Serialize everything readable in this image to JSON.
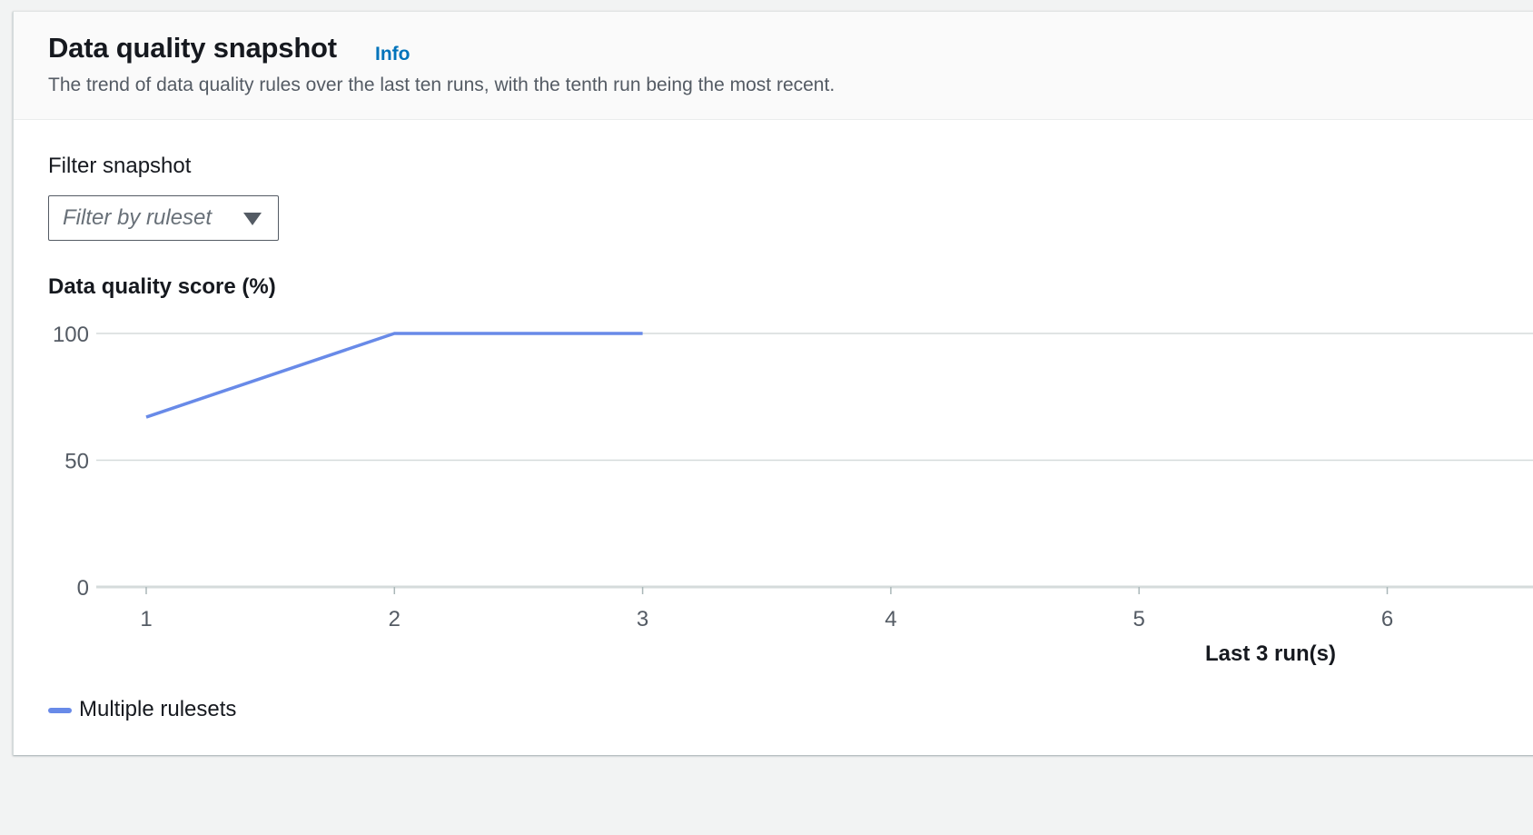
{
  "header": {
    "title": "Data quality snapshot",
    "info_label": "Info",
    "description": "The trend of data quality rules over the last ten runs, with the tenth run being the most recent."
  },
  "filter": {
    "label": "Filter snapshot",
    "placeholder": "Filter by ruleset"
  },
  "chart_data": {
    "type": "line",
    "title": "Data quality score (%)",
    "xlabel": "Last 3 run(s)",
    "ylabel": "",
    "x_ticks": [
      1,
      2,
      3,
      4,
      5,
      6
    ],
    "y_ticks": [
      0,
      50,
      100
    ],
    "ylim": [
      0,
      100
    ],
    "grid": true,
    "legend_position": "bottom-left",
    "series": [
      {
        "name": "Multiple rulesets",
        "color": "#688ae8",
        "x": [
          1,
          2,
          3
        ],
        "values": [
          67,
          100,
          100
        ]
      }
    ]
  }
}
